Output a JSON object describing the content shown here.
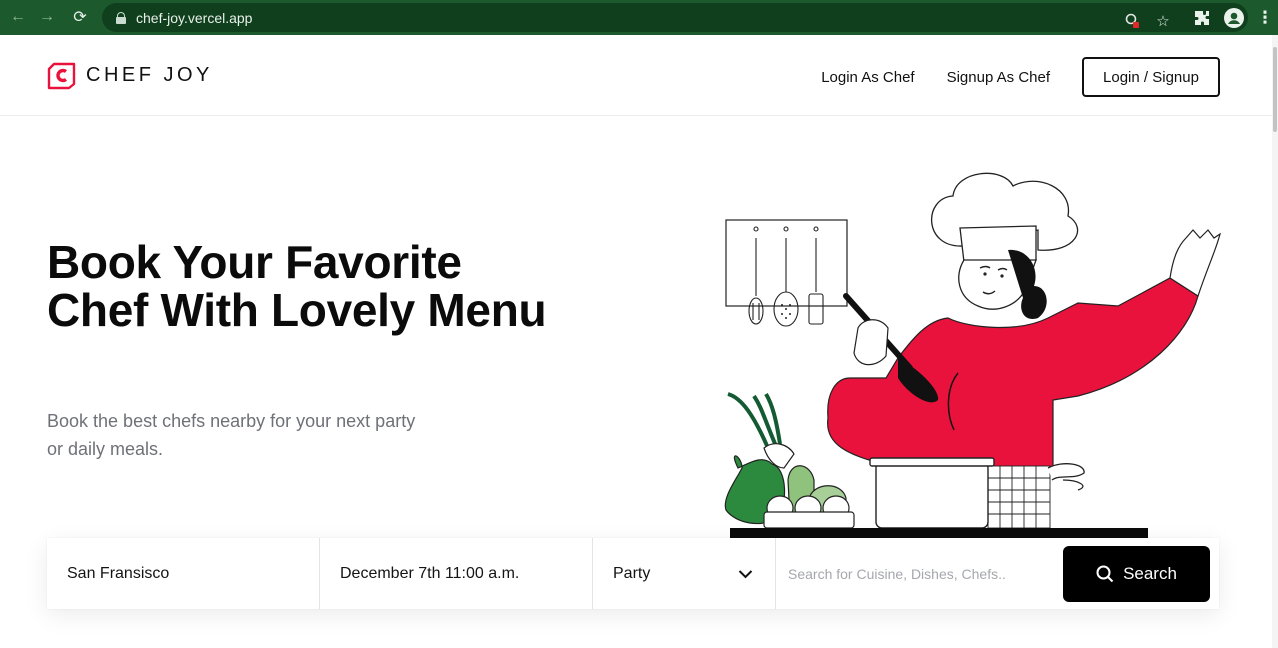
{
  "browser": {
    "url": "chef-joy.vercel.app",
    "back_glyph": "←",
    "forward_glyph": "→",
    "reload_glyph": "⟳",
    "star_glyph": "☆",
    "puzzle_glyph": "✚",
    "more_glyph": "⋮"
  },
  "site": {
    "brand": "CHEF JOY",
    "brand_color": "#e8123c"
  },
  "nav": {
    "login_chef": "Login As Chef",
    "signup_chef": "Signup As Chef",
    "login_signup": "Login / Signup"
  },
  "hero": {
    "title": "Book Your Favorite Chef With Lovely Menu",
    "subtitle": "Book the best chefs nearby for your next party or daily meals."
  },
  "search": {
    "location": "San Fransisco",
    "datetime": "December 7th 11:00 a.m.",
    "occasion": "Party",
    "query_placeholder": "Search for Cuisine, Dishes, Chefs..",
    "button_label": "Search"
  },
  "icons": {
    "lock": "lock-icon",
    "search": "search-icon",
    "dropdown": "chevron-down-icon"
  }
}
